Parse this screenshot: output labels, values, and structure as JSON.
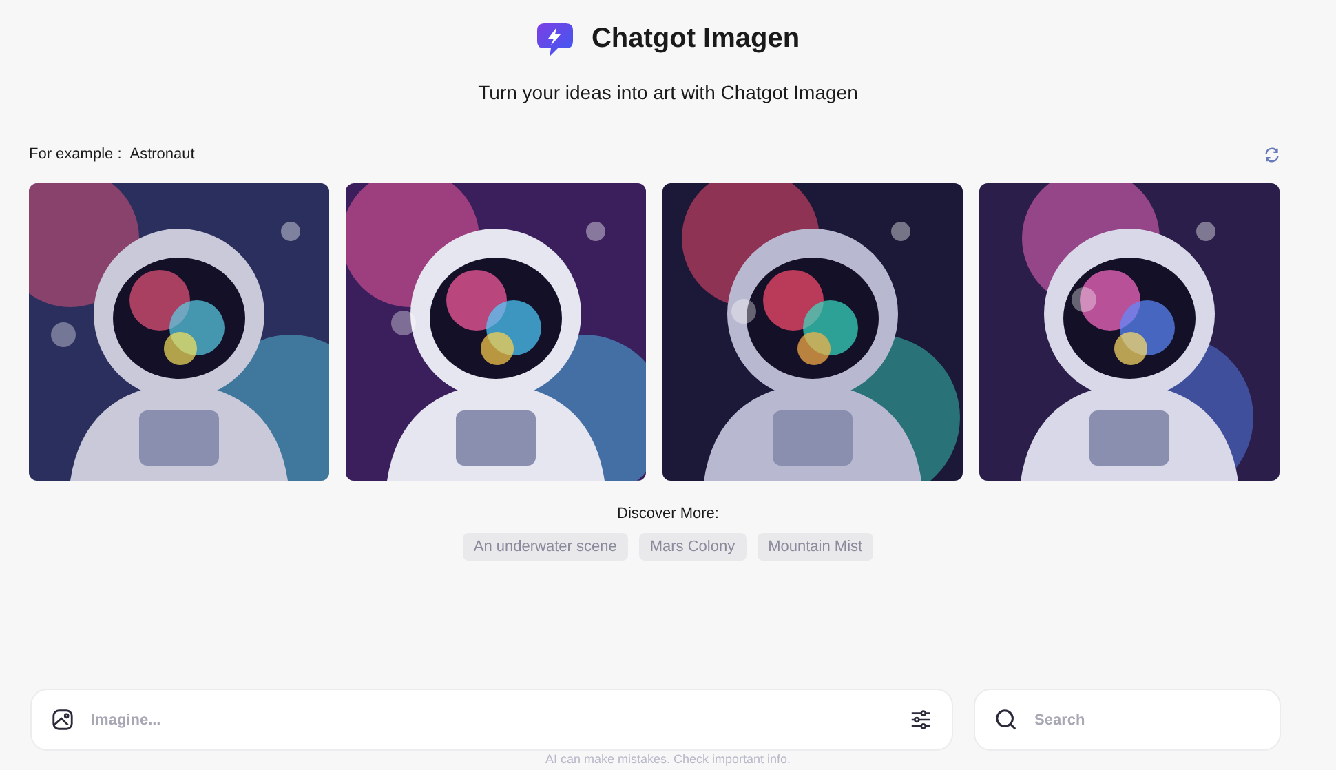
{
  "header": {
    "title": "Chatgot Imagen",
    "subtitle": "Turn your ideas into art with Chatgot Imagen"
  },
  "examples": {
    "label": "For example :",
    "topic": "Astronaut"
  },
  "discover": {
    "label": "Discover More:",
    "chips": [
      "An underwater scene",
      "Mars Colony",
      "Mountain Mist"
    ]
  },
  "prompt": {
    "placeholder": "Imagine..."
  },
  "search": {
    "placeholder": "Search"
  },
  "footer_note": "AI can make mistakes. Check important info."
}
